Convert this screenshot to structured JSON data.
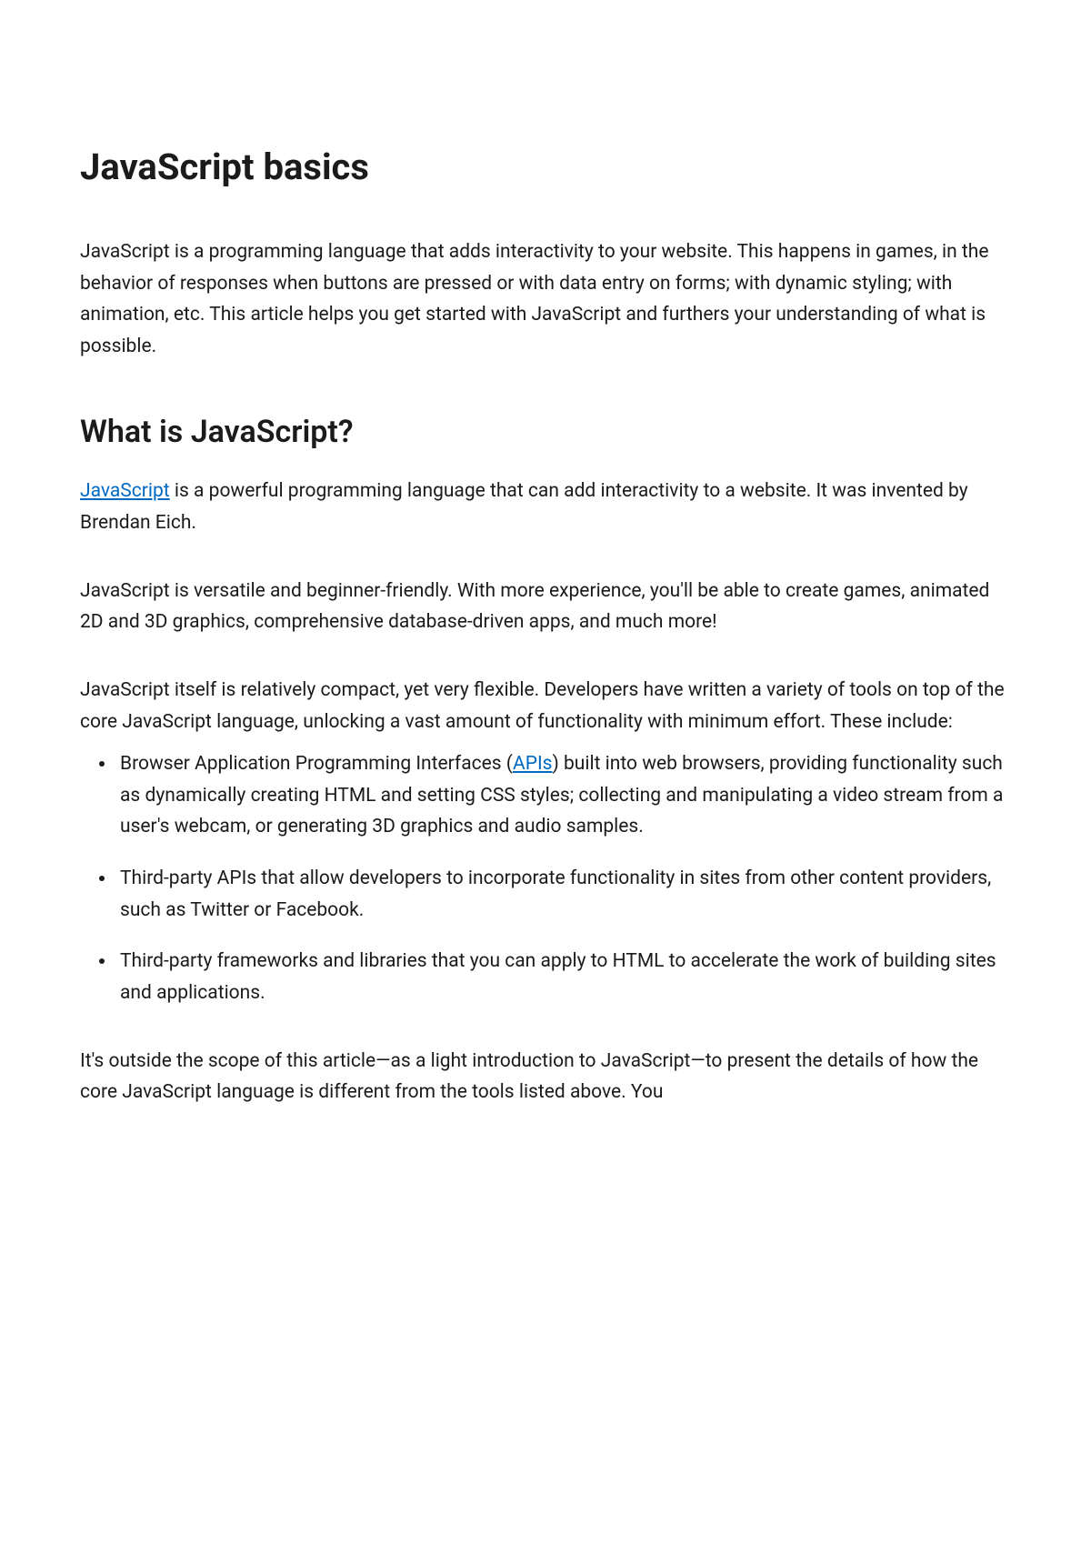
{
  "title": "JavaScript basics",
  "intro": "JavaScript is a programming language that adds interactivity to your website. This happens in games, in the behavior of responses when buttons are pressed or with data entry on forms; with dynamic styling; with animation, etc. This article helps you get started with JavaScript and furthers your understanding of what is possible.",
  "section1": {
    "heading": "What is JavaScript?",
    "p1": {
      "link": "JavaScript",
      "after": " is a powerful programming language that can add interactivity to a website. It was invented by Brendan Eich."
    },
    "p2": "JavaScript is versatile and beginner-friendly. With more experience, you'll be able to create games, animated 2D and 3D graphics, comprehensive database-driven apps, and much more!",
    "p3": "JavaScript itself is relatively compact, yet very flexible. Developers have written a variety of tools on top of the core JavaScript language, unlocking a vast amount of functionality with minimum effort. These include:",
    "list": {
      "item1": {
        "before": "Browser Application Programming Interfaces (",
        "link": "APIs",
        "after": ") built into web browsers, providing functionality such as dynamically creating HTML and setting CSS styles; collecting and manipulating a video stream from a user's webcam, or generating 3D graphics and audio samples."
      },
      "item2": "Third-party APIs that allow developers to incorporate functionality in sites from other content providers, such as Twitter or Facebook.",
      "item3": "Third-party frameworks and libraries that you can apply to HTML to accelerate the work of building sites and applications."
    },
    "p4_partial": "It's outside the scope of this article—as a light introduction to JavaScript—to present the details of how the core JavaScript language is different from the tools listed above. You"
  }
}
